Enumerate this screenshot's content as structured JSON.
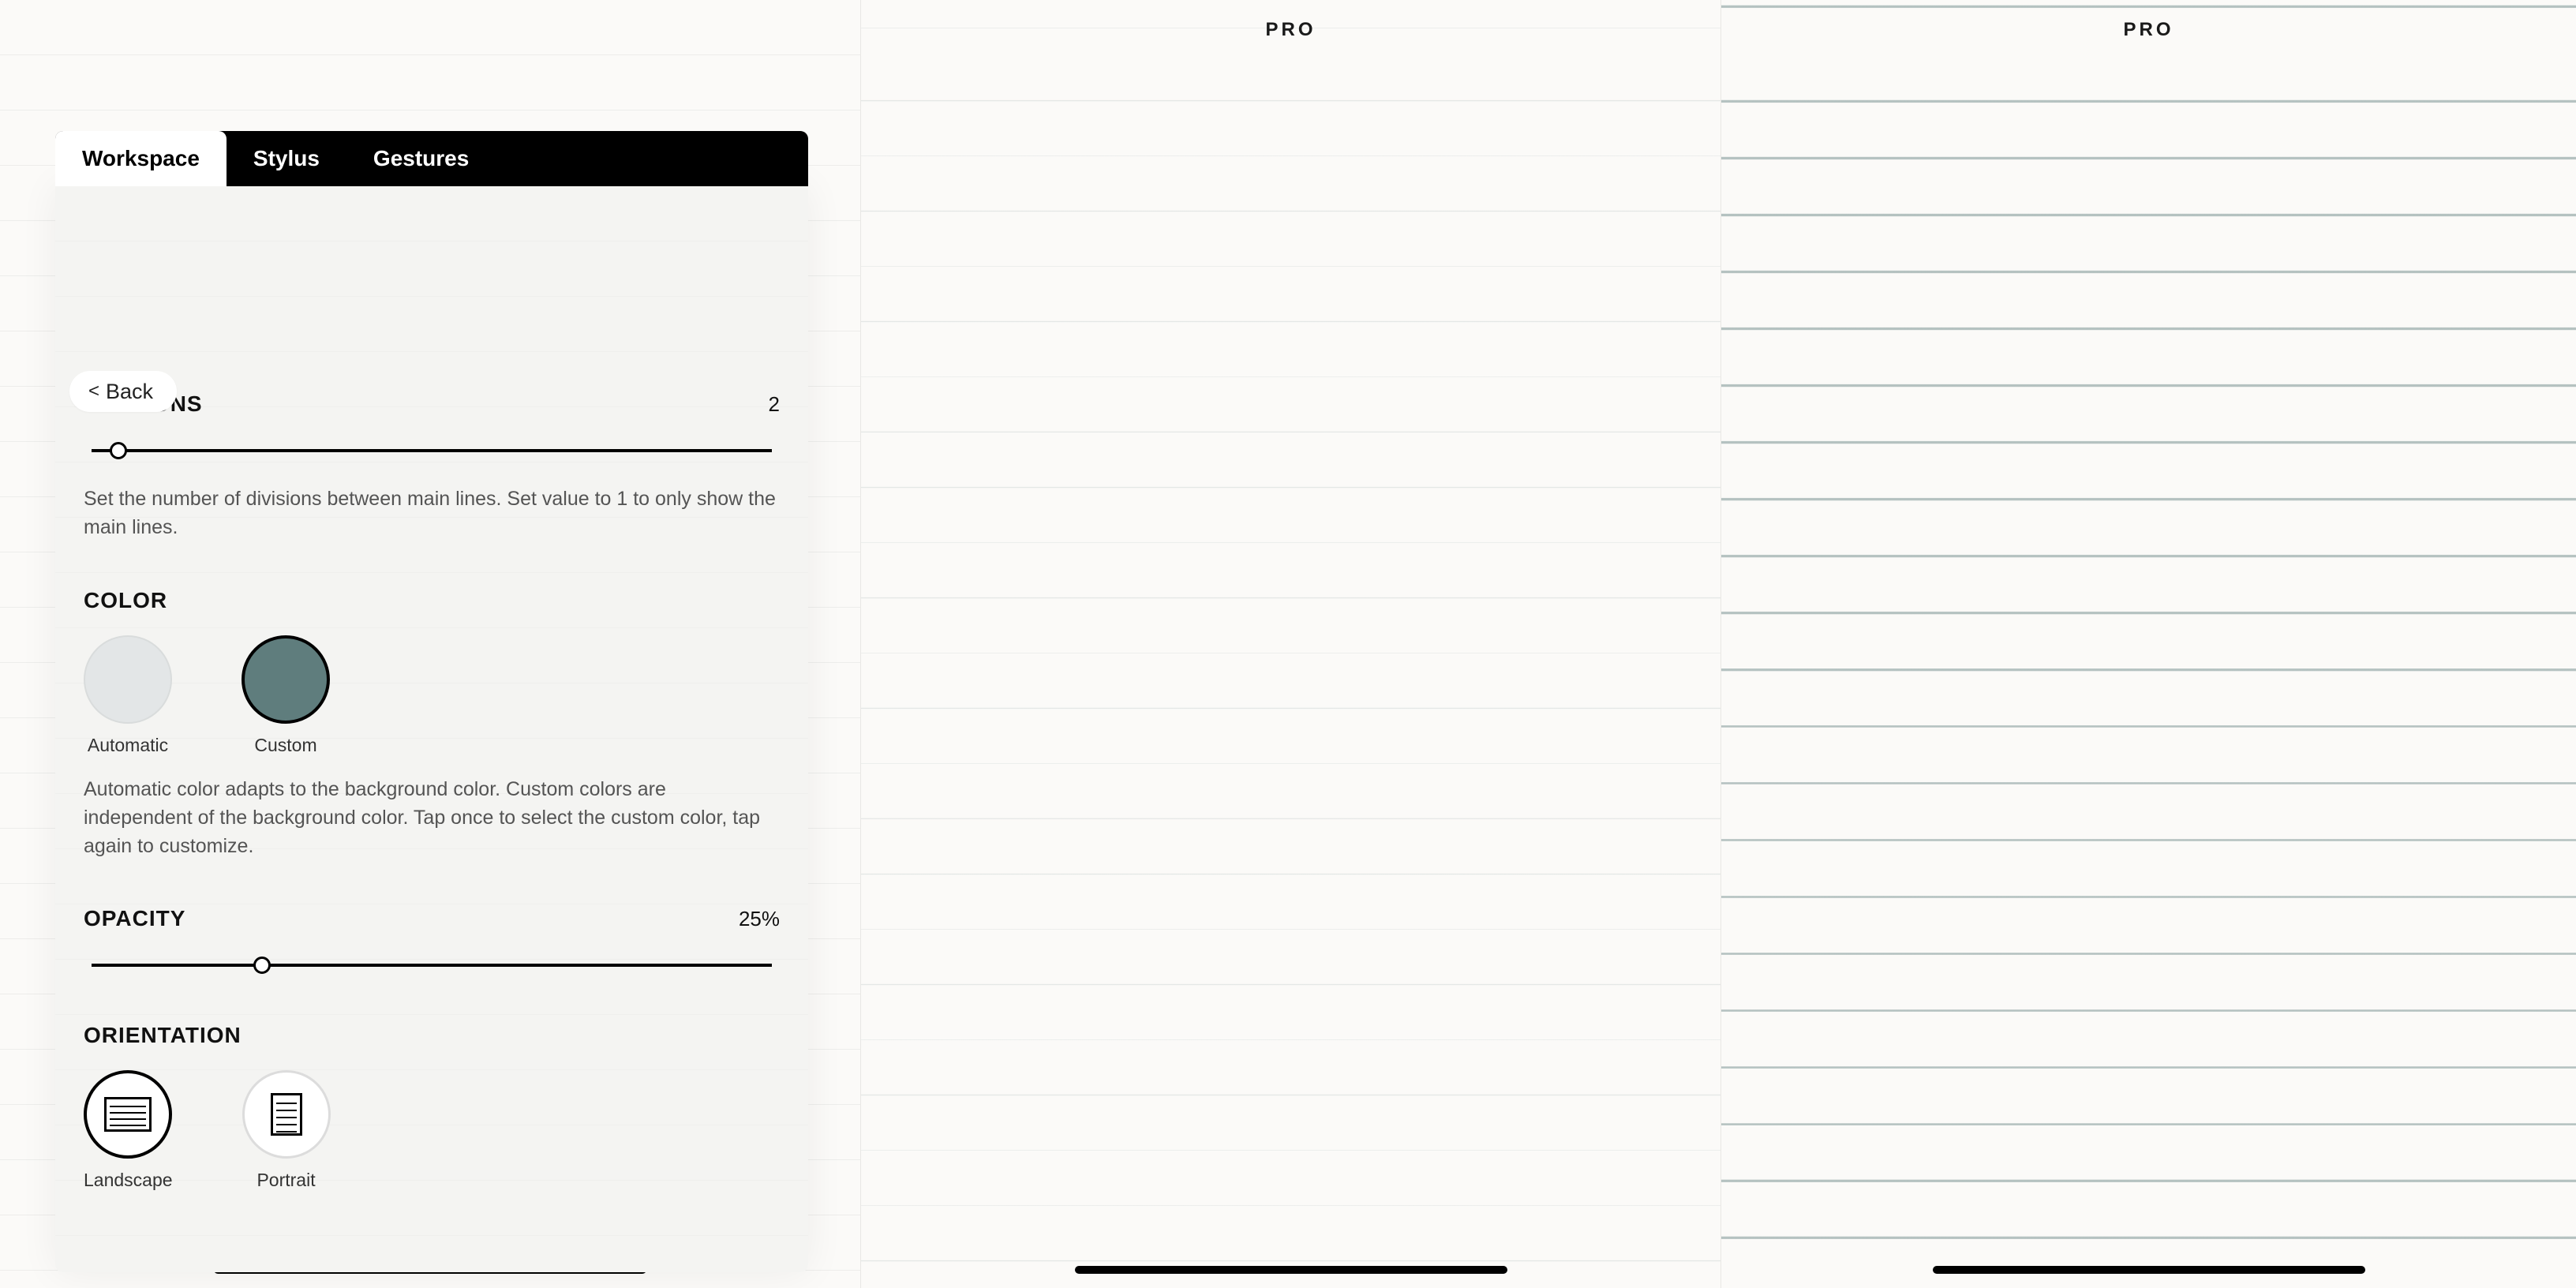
{
  "tabs": {
    "workspace": "Workspace",
    "stylus": "Stylus",
    "gestures": "Gestures"
  },
  "back": {
    "label": "Back"
  },
  "divisions": {
    "title": "DIVISIONS",
    "value": "2",
    "slider_percent": 4,
    "help": "Set the number of divisions between main lines. Set value to 1 to only show the main lines."
  },
  "color": {
    "title": "COLOR",
    "automatic_label": "Automatic",
    "custom_label": "Custom",
    "custom_hex": "#5f7d7d",
    "help": "Automatic color adapts to the background color. Custom colors are independent of the background color. Tap once to select the custom color, tap again to customize."
  },
  "opacity": {
    "title": "OPACITY",
    "value": "25%",
    "slider_percent": 25
  },
  "orientation": {
    "title": "ORIENTATION",
    "landscape_label": "Landscape",
    "portrait_label": "Portrait"
  },
  "preview": {
    "badge": "PRO"
  }
}
